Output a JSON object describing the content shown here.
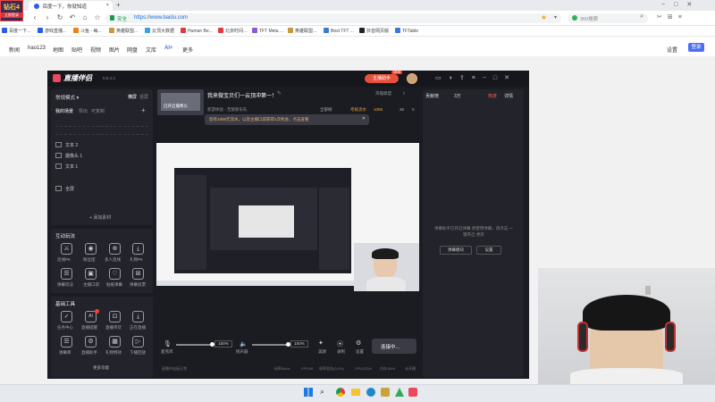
{
  "browser": {
    "logo_text": "钻石4",
    "logo_sub": "立即登录",
    "tabs": [
      "百度一下，你就知道",
      "×"
    ],
    "url": "https://www.baidu.com",
    "secure_label": "安全",
    "search_placeholder": "360搜索",
    "bookmarks": [
      "百度一下...",
      "游戏直播...",
      "斗鱼 - 每...",
      "英雄联盟...",
      "云顶大数据",
      "Human Be...",
      "北京时间...",
      "TFT Meta ...",
      "英雄联盟...",
      "Best TFT ...",
      "抖音网页版",
      "TFTable"
    ]
  },
  "site_nav": {
    "links": [
      "新闻",
      "hao123",
      "地图",
      "贴吧",
      "视频",
      "图片",
      "网盘",
      "文库",
      "AI+",
      "更多"
    ],
    "settings": "设置",
    "login": "登录"
  },
  "app": {
    "title": "直播伴侣",
    "version": "6.5.4.4",
    "live_badge": "主播助手",
    "new_badge": "NEW",
    "mode": "常规模式",
    "orientation": [
      "横屏",
      "竖屏"
    ],
    "scene_tabs": [
      "我的场景",
      "导出",
      "可复制"
    ],
    "scenes": [
      "文本 2",
      "摄像头 1",
      "文本 1",
      "全屏"
    ],
    "add_material": "+ 添加素材",
    "interaction_title": "互动玩法",
    "interaction_items": [
      "连线PK",
      "粉丝团",
      "多人连线",
      "礼物PK",
      "弹幕玩法",
      "主播口袋",
      "贴纸弹幕",
      "弹幕投票"
    ],
    "tools_title": "基础工具",
    "tool_items": [
      "任务中心",
      "直播提醒",
      "直播带货",
      "正在直播",
      "弹幕库",
      "直播助手",
      "礼物特效",
      "下播回放"
    ],
    "more_tools": "更多功能",
    "stream_title": "我来做宝贝们一云顶冲第一！",
    "category": "英雄联盟",
    "stream_subtitle": "新游体验 - 无限新乐队",
    "stats": [
      "全部榜",
      "考核流水",
      "1058",
      "36",
      "0"
    ],
    "tooltip": "您有1058元流水，以及主播口袋获得1次机会，点击查看",
    "preview_label": "已开启摄像头",
    "right_tabs": [
      "贡献榜",
      "3万"
    ],
    "right_label": "主播",
    "right_tab2": "热度",
    "right_tab3": "详情",
    "right_msg": "弹幕助手已开启弹幕 请使用弹幕，请点击 一键开启 更新",
    "right_buttons": [
      "弹幕模块",
      "设置"
    ],
    "mic_label": "麦克风",
    "mic_volume": "150%",
    "speaker_label": "扬声器",
    "speaker_volume": "100%",
    "effects": [
      "美颜",
      "录制",
      "设置"
    ],
    "go_live": "连接中...",
    "status_bar": [
      "直播中连接正常",
      "码率0kb/s",
      "FPS:60",
      "帧率丢失(0.0%)",
      "CPU(22)%",
      "内存:54%",
      "未开播"
    ]
  }
}
